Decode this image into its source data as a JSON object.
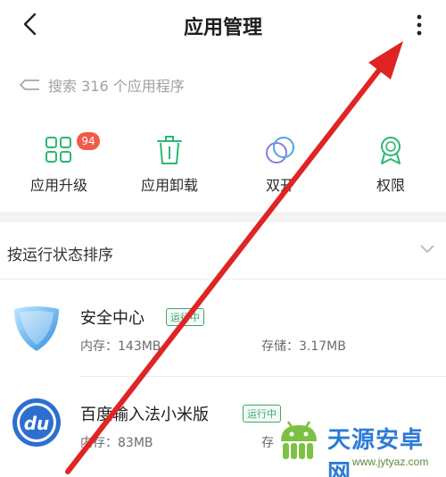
{
  "header": {
    "title": "应用管理"
  },
  "search": {
    "label": "搜索 316 个应用程序"
  },
  "actions": [
    {
      "label": "应用升级",
      "icon": "grid-apps-icon",
      "badge": "94"
    },
    {
      "label": "应用卸载",
      "icon": "trash-icon"
    },
    {
      "label": "双开",
      "icon": "dual-circles-icon"
    },
    {
      "label": "权限",
      "icon": "ribbon-badge-icon"
    }
  ],
  "sort": {
    "label": "按运行状态排序"
  },
  "apps": [
    {
      "name": "安全中心",
      "status": "运行中",
      "memory": "内存：143MB",
      "storage": "存储：3.17MB",
      "icon": "shield-icon"
    },
    {
      "name": "百度输入法小米版",
      "status": "运行中",
      "memory": "内存：83MB",
      "storage": "存",
      "icon": "du-logo-icon"
    }
  ],
  "watermark": {
    "title": "天源安卓网",
    "url": "www.jytyaz.com"
  },
  "colors": {
    "accent": "#2bb673",
    "badge": "#f25a4a",
    "arrow": "#e02424",
    "running": "#3aa76d"
  }
}
